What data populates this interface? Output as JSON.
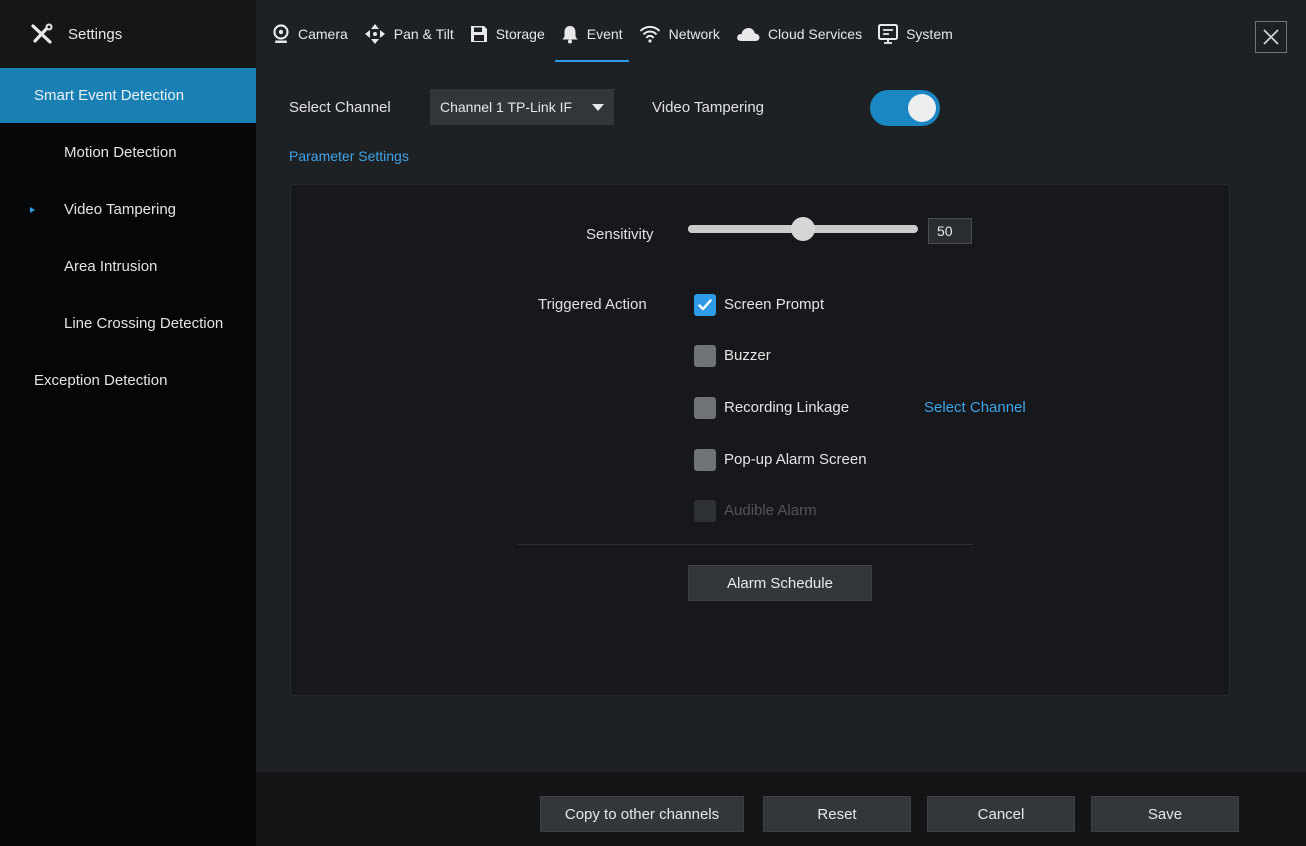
{
  "header": {
    "title": "Settings",
    "tabs": [
      {
        "label": "Camera",
        "icon": "camera-icon"
      },
      {
        "label": "Pan & Tilt",
        "icon": "pan-tilt-icon"
      },
      {
        "label": "Storage",
        "icon": "storage-icon"
      },
      {
        "label": "Event",
        "icon": "bell-icon",
        "active": true
      },
      {
        "label": "Network",
        "icon": "wifi-icon"
      },
      {
        "label": "Cloud Services",
        "icon": "cloud-icon"
      },
      {
        "label": "System",
        "icon": "monitor-icon"
      }
    ]
  },
  "sidebar": {
    "items": [
      {
        "label": "Smart Event Detection",
        "active": true
      },
      {
        "label": "Motion Detection"
      },
      {
        "label": "Video Tampering",
        "current": true
      },
      {
        "label": "Area Intrusion"
      },
      {
        "label": "Line Crossing Detection"
      },
      {
        "label": "Exception Detection"
      }
    ]
  },
  "main": {
    "select_channel_label": "Select Channel",
    "channel_value": "Channel 1 TP-Link IF",
    "feature_label": "Video Tampering",
    "feature_enabled": true,
    "parameter_settings_label": "Parameter Settings",
    "sensitivity_label": "Sensitivity",
    "sensitivity_value": "50",
    "triggered_action_label": "Triggered Action",
    "actions": [
      {
        "label": "Screen Prompt",
        "checked": true,
        "disabled": false
      },
      {
        "label": "Buzzer",
        "checked": false,
        "disabled": false
      },
      {
        "label": "Recording Linkage",
        "checked": false,
        "disabled": false
      },
      {
        "label": "Pop-up Alarm Screen",
        "checked": false,
        "disabled": false
      },
      {
        "label": "Audible Alarm",
        "checked": false,
        "disabled": true
      }
    ],
    "select_channel_link": "Select Channel",
    "alarm_schedule_button": "Alarm Schedule"
  },
  "footer": {
    "copy_label": "Copy to other channels",
    "reset_label": "Reset",
    "cancel_label": "Cancel",
    "save_label": "Save"
  },
  "colors": {
    "accent": "#2f9be6",
    "sidebar_active": "#1a7fb3",
    "toggle_on": "#1a87c2"
  }
}
